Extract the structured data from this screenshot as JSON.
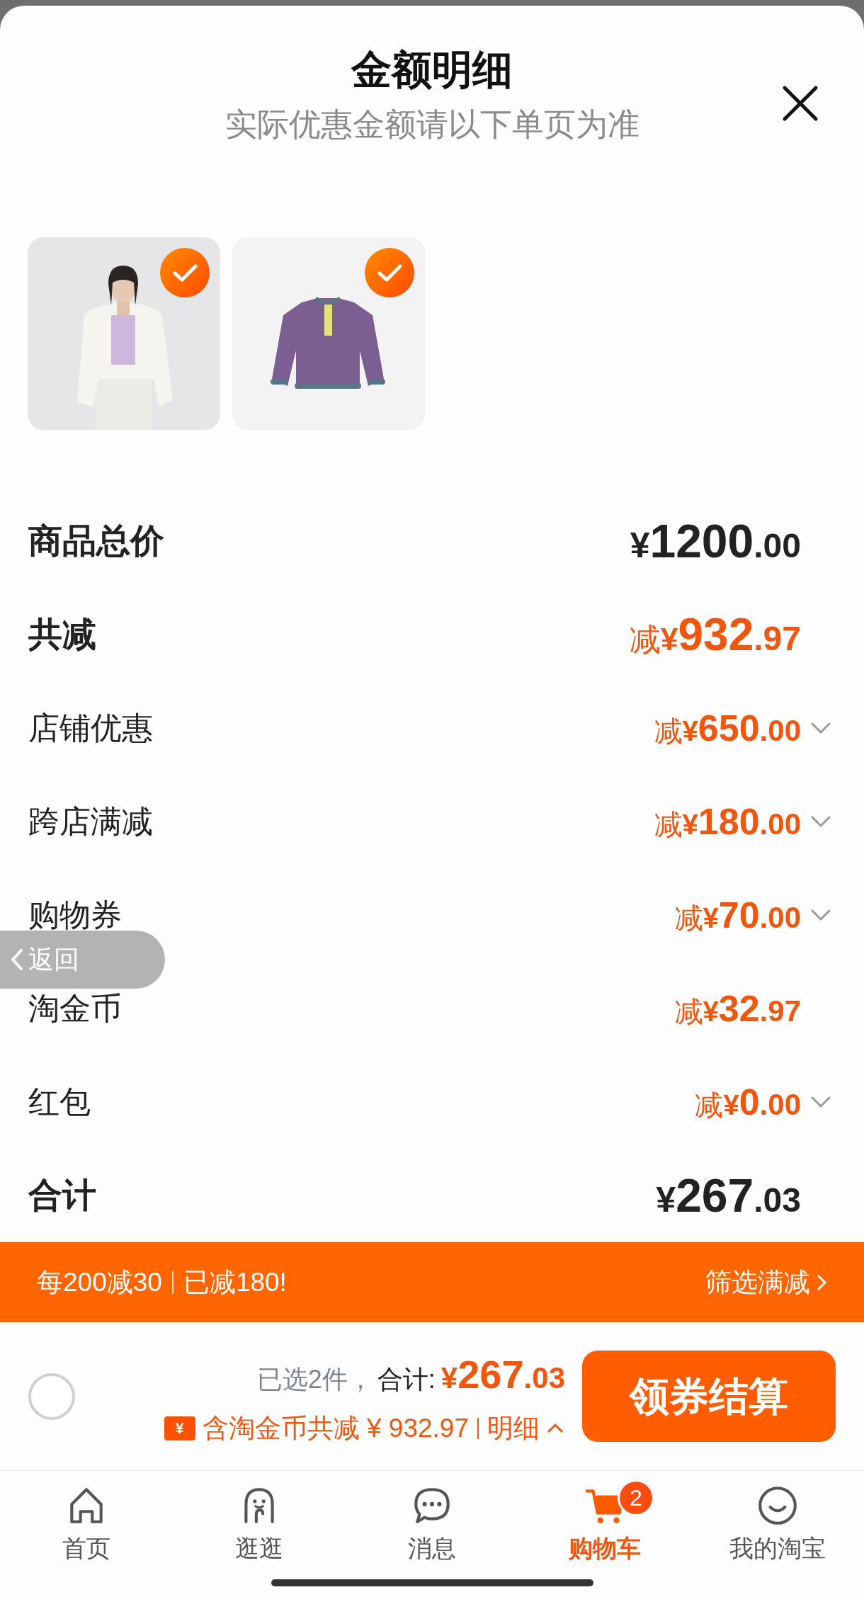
{
  "header": {
    "title": "金额明细",
    "subtitle": "实际优惠金额请以下单页为准"
  },
  "products": [
    {
      "kind": "picture",
      "checked": true
    },
    {
      "kind": "picture",
      "checked": true
    }
  ],
  "rows": [
    {
      "kind": "summary",
      "label": "商品总价",
      "currency": "¥",
      "whole": "1200",
      "fraction": ".00",
      "expandable": false
    },
    {
      "kind": "discount_total",
      "label": "共减",
      "minus": "减",
      "currency": "¥",
      "whole": "932",
      "fraction": ".97",
      "expandable": false
    },
    {
      "kind": "discount",
      "label": "店铺优惠",
      "minus": "减",
      "currency": "¥",
      "whole": "650",
      "fraction": ".00",
      "expandable": true
    },
    {
      "kind": "discount",
      "label": "跨店满减",
      "minus": "减",
      "currency": "¥",
      "whole": "180",
      "fraction": ".00",
      "expandable": true
    },
    {
      "kind": "discount",
      "label": "购物券",
      "minus": "减",
      "currency": "¥",
      "whole": "70",
      "fraction": ".00",
      "expandable": true
    },
    {
      "kind": "discount",
      "label": "淘金币",
      "minus": "减",
      "currency": "¥",
      "whole": "32",
      "fraction": ".97",
      "expandable": false
    },
    {
      "kind": "discount",
      "label": "红包",
      "minus": "减",
      "currency": "¥",
      "whole": "0",
      "fraction": ".00",
      "expandable": true
    },
    {
      "kind": "summary",
      "label": "合计",
      "currency": "¥",
      "whole": "267",
      "fraction": ".03",
      "expandable": false
    }
  ],
  "back_button": {
    "label": "返回"
  },
  "banner": {
    "rule": "每200减30",
    "status": "已减180!",
    "link": "筛选满减"
  },
  "checkout": {
    "select_all_checked": false,
    "selected_count": "已选2件，",
    "total_label": "合计:",
    "currency": "¥",
    "whole": "267",
    "fraction": ".03",
    "coupon_symbol": "¥",
    "savings": "含淘金币共减 ¥ 932.97",
    "detail": "明细",
    "detail_expanded": true,
    "button": "领券结算"
  },
  "nav": [
    {
      "label": "首页",
      "selected": false
    },
    {
      "label": "逛逛",
      "selected": false
    },
    {
      "label": "消息",
      "selected": false
    },
    {
      "label": "购物车",
      "selected": true,
      "badge": "2"
    },
    {
      "label": "我的淘宝",
      "selected": false
    }
  ]
}
